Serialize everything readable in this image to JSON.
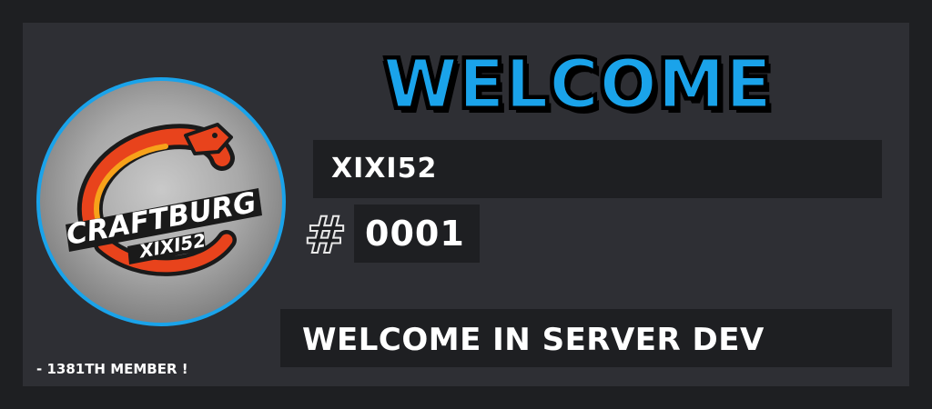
{
  "title": "WELCOME",
  "avatar": {
    "logo_text_top": "CRAFTBURG",
    "logo_text_bottom": "XIXI52"
  },
  "username": "XIXI52",
  "discriminator": {
    "symbol": "#",
    "value": "0001"
  },
  "message": "WELCOME IN SERVER DEV",
  "member_count_text": "- 1381TH MEMBER !",
  "colors": {
    "accent": "#1aa3ea",
    "card": "#2e2f34",
    "field": "#1e1f22",
    "background": "#1e1f22"
  }
}
